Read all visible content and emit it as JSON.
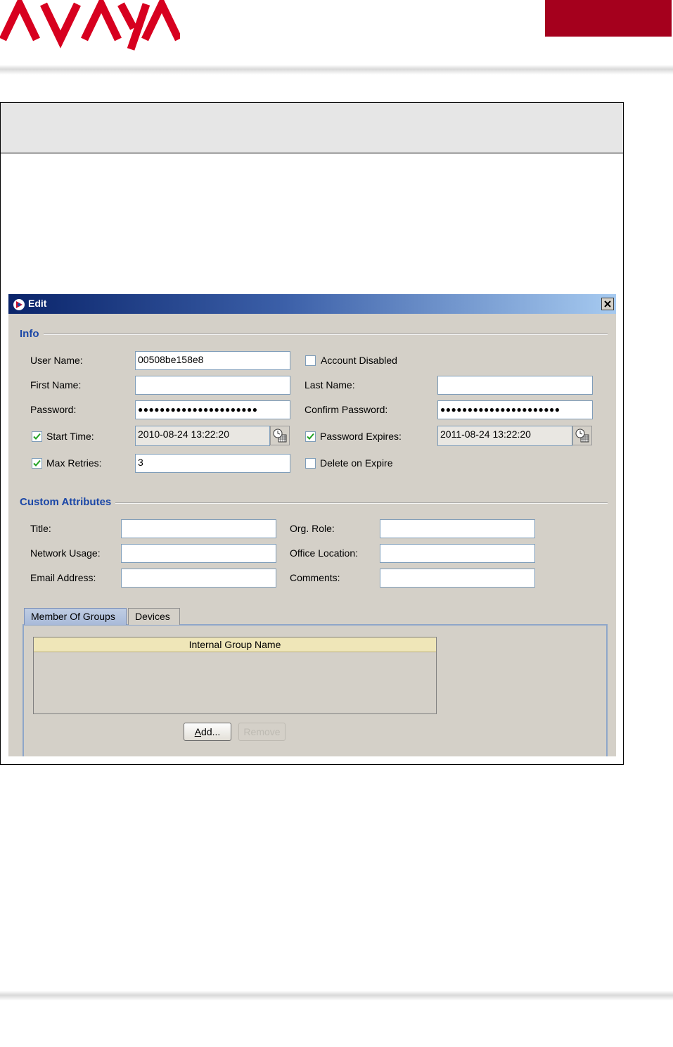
{
  "brand": {
    "logo_text": "AVAYA",
    "logo_color": "#d7001f",
    "block_color": "#a5001d"
  },
  "dialog": {
    "title": "Edit",
    "info": {
      "heading": "Info",
      "user_name_label": "User Name:",
      "user_name_value": "00508be158e8",
      "account_disabled_label": "Account Disabled",
      "account_disabled_checked": false,
      "first_name_label": "First Name:",
      "first_name_value": "",
      "last_name_label": "Last Name:",
      "last_name_value": "",
      "password_label": "Password:",
      "password_value": "●●●●●●●●●●●●●●●●●●●●●●",
      "confirm_password_label": "Confirm Password:",
      "confirm_password_value": "●●●●●●●●●●●●●●●●●●●●●●",
      "start_time_label": "Start Time:",
      "start_time_checked": true,
      "start_time_value": "2010-08-24 13:22:20",
      "password_expires_label": "Password Expires:",
      "password_expires_checked": true,
      "password_expires_value": "2011-08-24 13:22:20",
      "max_retries_label": "Max Retries:",
      "max_retries_checked": true,
      "max_retries_value": "3",
      "delete_on_expire_label": "Delete on Expire",
      "delete_on_expire_checked": false
    },
    "custom_attributes": {
      "heading": "Custom Attributes",
      "title_label": "Title:",
      "org_role_label": "Org. Role:",
      "network_usage_label": "Network Usage:",
      "office_location_label": "Office Location:",
      "email_address_label": "Email Address:",
      "comments_label": "Comments:"
    },
    "tabs": [
      {
        "label": "Member Of Groups",
        "active": true
      },
      {
        "label": "Devices",
        "active": false
      }
    ],
    "groups_table": {
      "column": "Internal Group Name",
      "rows": []
    },
    "add_button": "Add...",
    "remove_button": "Remove"
  }
}
